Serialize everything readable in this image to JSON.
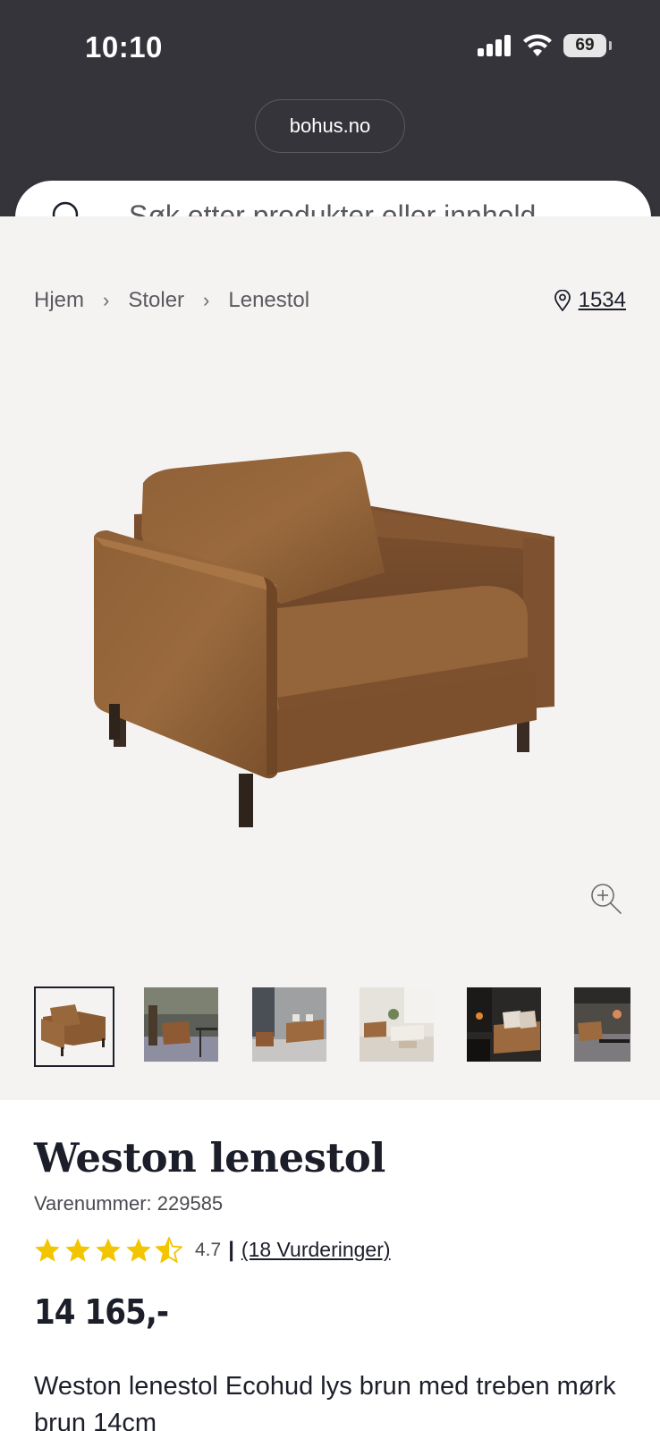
{
  "status_bar": {
    "time": "10:10",
    "battery": "69"
  },
  "browser": {
    "url": "bohus.no"
  },
  "search": {
    "placeholder": "Søk etter produkter eller innhold ..."
  },
  "breadcrumb": [
    "Hjem",
    "Stoler",
    "Lenestol"
  ],
  "store": {
    "id": "1534"
  },
  "product": {
    "title": "Weston lenestol",
    "sku_label": "Varenummer: 229585",
    "rating_value": "4.7",
    "rating_separator": "|",
    "rating_count": "(18 Vurderinger)",
    "rating_stars": 4.7,
    "price": "14 165,-",
    "description": "Weston lenestol Ecohud lys brun med treben mørk brun 14cm"
  },
  "gallery": {
    "thumbnail_count": 6,
    "selected_index": 0
  },
  "colors": {
    "accent_star": "#f2c500",
    "top_bar": "#35343a",
    "gallery_bg": "#f5f3f2"
  }
}
